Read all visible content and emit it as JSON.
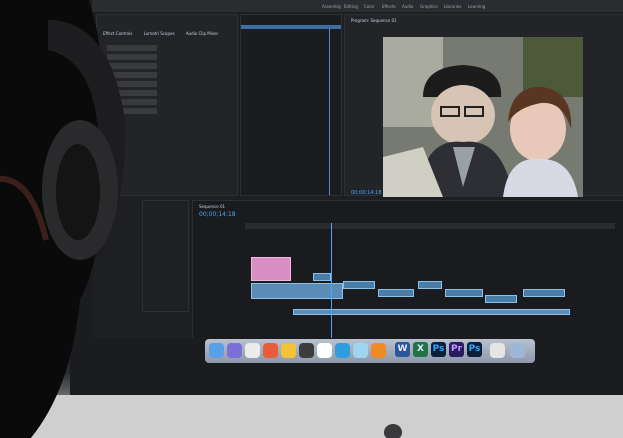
{
  "menu": {
    "items": [
      "Assembly",
      "Editing",
      "Color",
      "Effects",
      "Audio",
      "Graphics",
      "Libraries",
      "Learning"
    ]
  },
  "panels": {
    "source_tabs": [
      "Effect Controls",
      "Lumetri Scopes",
      "Audio Clip Mixer"
    ],
    "program_title": "Program: Sequence 01",
    "program_timecode": "00;00;14;18",
    "timeline_tab": "Sequence 01",
    "timeline_time": "00;00;14;18"
  },
  "dock": {
    "text_icons": [
      "W",
      "X",
      "Ps",
      "Pr",
      "Ps"
    ]
  },
  "colors": {
    "accent": "#4aa3ff",
    "clip": "#4a7ca8",
    "clip_pink": "#d98fc4",
    "premiere": "#2a1a5e",
    "word": "#2b579a",
    "excel": "#217346",
    "photoshop": "#0a1f3a"
  }
}
